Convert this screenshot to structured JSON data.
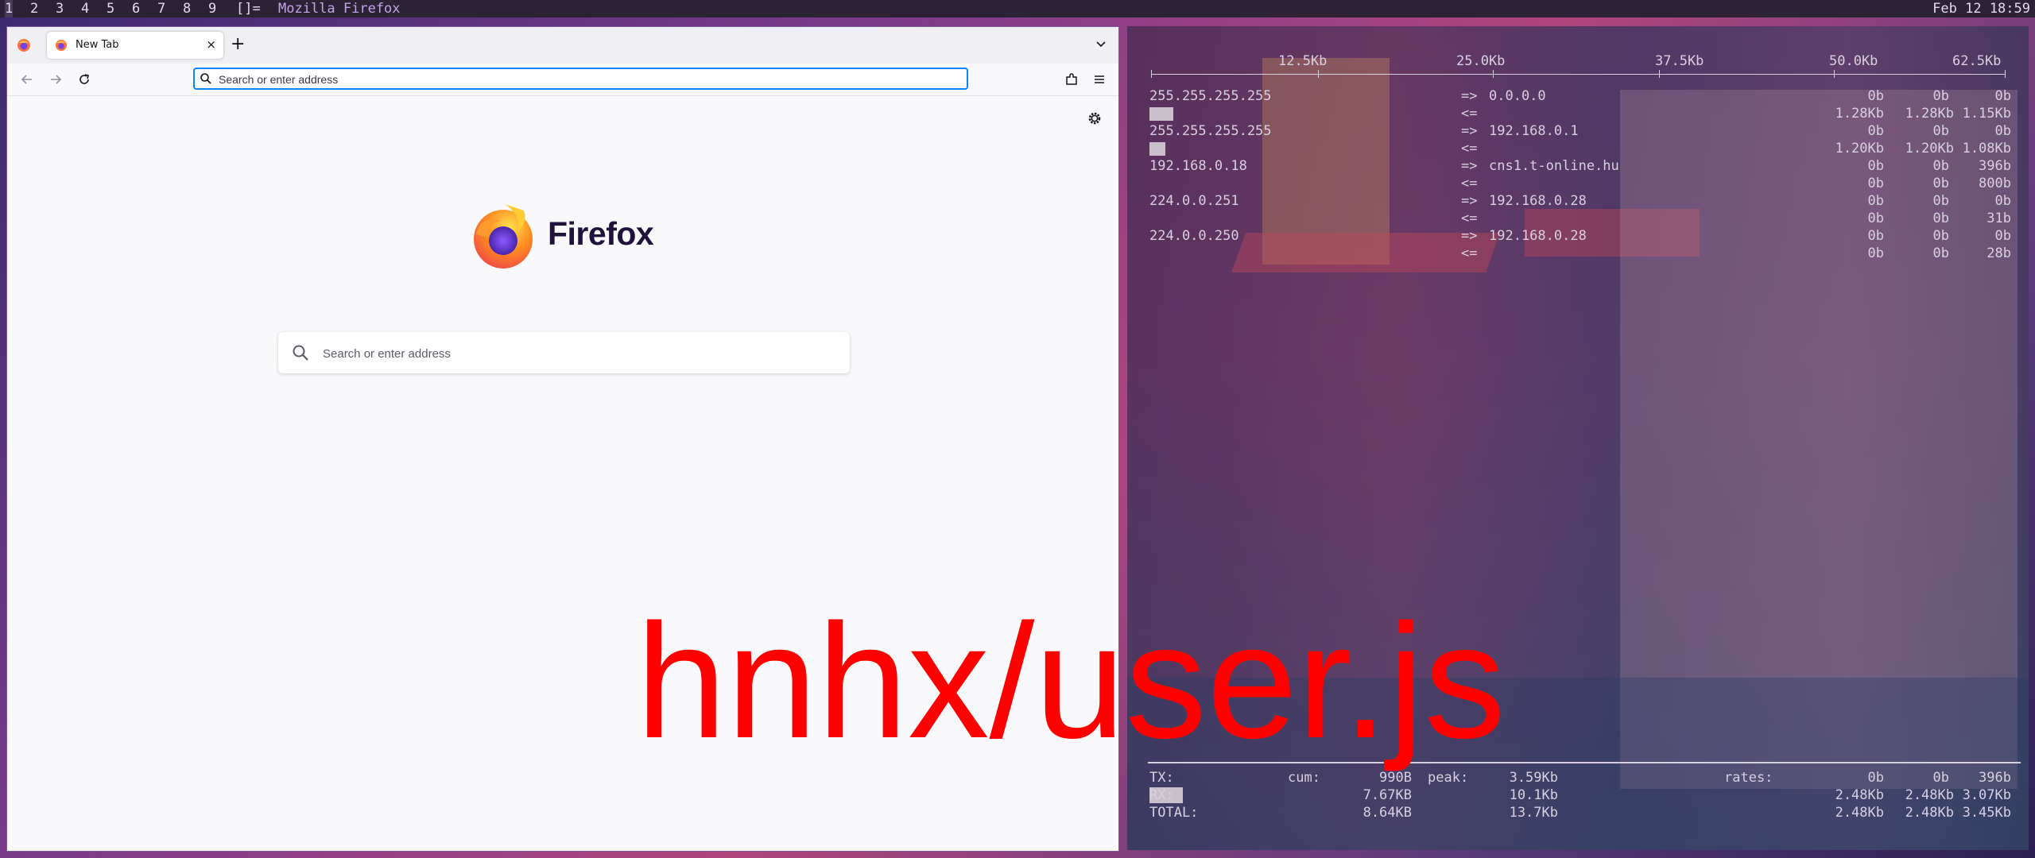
{
  "topbar": {
    "workspaces": [
      "1",
      "2",
      "3",
      "4",
      "5",
      "6",
      "7",
      "8",
      "9"
    ],
    "layout": "[]=",
    "window_title": "Mozilla Firefox",
    "clock": "Feb 12 18:59"
  },
  "firefox": {
    "tab": {
      "label": "New Tab"
    },
    "new_tab_symbol": "+",
    "tab_close_symbol": "×",
    "urlbar": {
      "placeholder": "Search or enter address"
    },
    "wordmark": "Firefox",
    "search": {
      "placeholder": "Search or enter address"
    },
    "icons": [
      "firefox-view-icon",
      "back-icon",
      "forward-icon",
      "reload-icon",
      "extensions-icon",
      "hamburger-menu-icon",
      "settings-gear-icon",
      "tab-list-chevron-icon",
      "search-icon"
    ]
  },
  "iftop": {
    "scale": [
      "12.5Kb",
      "25.0Kb",
      "37.5Kb",
      "50.0Kb",
      "62.5Kb"
    ],
    "flows": [
      {
        "host": "255.255.255.255",
        "dir_out": "=>",
        "peer": "0.0.0.0",
        "out": [
          "0b",
          "0b",
          "0b"
        ],
        "dir_in": "<=",
        "in": [
          "1.28Kb",
          "1.28Kb",
          "1.15Kb"
        ]
      },
      {
        "host": "255.255.255.255",
        "dir_out": "=>",
        "peer": "192.168.0.1",
        "out": [
          "0b",
          "0b",
          "0b"
        ],
        "dir_in": "<=",
        "in": [
          "1.20Kb",
          "1.20Kb",
          "1.08Kb"
        ]
      },
      {
        "host": "192.168.0.18",
        "dir_out": "=>",
        "peer": "cns1.t-online.hu",
        "out": [
          "0b",
          "0b",
          "396b"
        ],
        "dir_in": "<=",
        "in": [
          "0b",
          "0b",
          "800b"
        ]
      },
      {
        "host": "224.0.0.251",
        "dir_out": "=>",
        "peer": "192.168.0.28",
        "out": [
          "0b",
          "0b",
          "0b"
        ],
        "dir_in": "<=",
        "in": [
          "0b",
          "0b",
          "31b"
        ]
      },
      {
        "host": "224.0.0.250",
        "dir_out": "=>",
        "peer": "192.168.0.28",
        "out": [
          "0b",
          "0b",
          "0b"
        ],
        "dir_in": "<=",
        "in": [
          "0b",
          "0b",
          "28b"
        ]
      }
    ],
    "footer": {
      "tx_label": "TX:",
      "cum_label": "cum:",
      "peak_label": "peak:",
      "rates_label": "rates:",
      "rx_label": "RX:",
      "total_label": "TOTAL:",
      "tx": {
        "cum": "990B",
        "peak": "3.59Kb",
        "rates": [
          "0b",
          "0b",
          "396b"
        ]
      },
      "rx": {
        "cum": "7.67KB",
        "peak": "10.1Kb",
        "rates": [
          "2.48Kb",
          "2.48Kb",
          "3.07Kb"
        ]
      },
      "total": {
        "cum": "8.64KB",
        "peak": "13.7Kb",
        "rates": [
          "2.48Kb",
          "2.48Kb",
          "3.45Kb"
        ]
      }
    }
  },
  "overlay": {
    "text": "hnhx/user.js",
    "color": "#ff0000"
  }
}
